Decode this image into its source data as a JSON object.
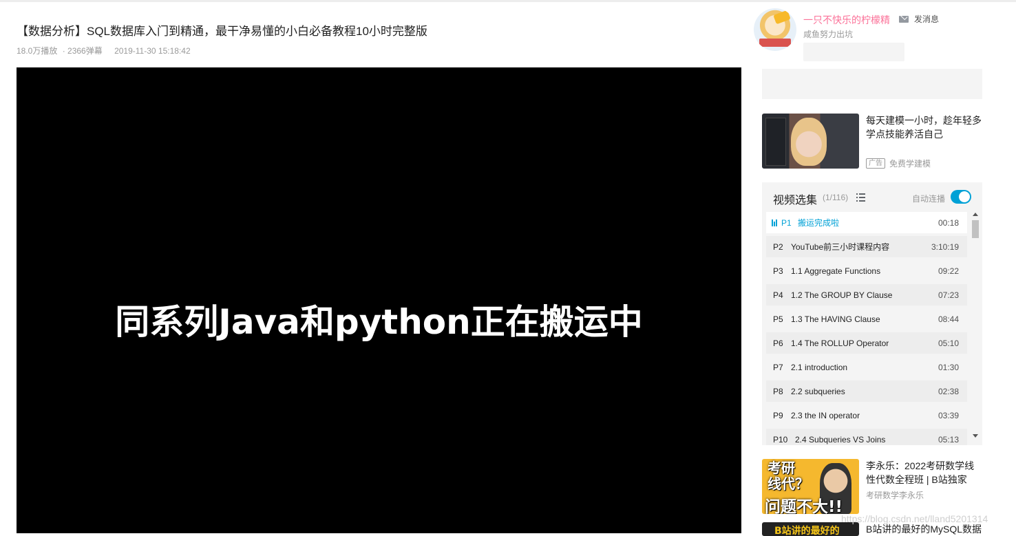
{
  "video": {
    "title": "【数据分析】SQL数据库入门到精通，最干净易懂的小白必备教程10小时完整版",
    "views": "18.0万播放",
    "danmaku": "· 2366弹幕",
    "date": "2019-11-30 15:18:42",
    "subtitle_text": "同系列Java和python正在搬运中"
  },
  "uploader": {
    "name": "一只不快乐的柠檬精",
    "message_label": "发消息",
    "description": "咸鱼努力出坑"
  },
  "ad": {
    "title": "每天建模一小时，趁年轻多学点技能养活自己",
    "badge": "广告",
    "source": "免费学建模"
  },
  "playlist": {
    "title": "视频选集",
    "count": "(1/116)",
    "autoplay_label": "自动连播",
    "autoplay_on": true,
    "items": [
      {
        "p": "P1",
        "title": "搬运完成啦",
        "duration": "00:18",
        "active": true
      },
      {
        "p": "P2",
        "title": "YouTube前三小时课程内容",
        "duration": "3:10:19"
      },
      {
        "p": "P3",
        "title": "1.1 Aggregate Functions",
        "duration": "09:22"
      },
      {
        "p": "P4",
        "title": "1.2 The GROUP BY Clause",
        "duration": "07:23"
      },
      {
        "p": "P5",
        "title": "1.3 The HAVING Clause",
        "duration": "08:44"
      },
      {
        "p": "P6",
        "title": "1.4 The ROLLUP Operator",
        "duration": "05:10"
      },
      {
        "p": "P7",
        "title": "2.1 introduction",
        "duration": "01:30"
      },
      {
        "p": "P8",
        "title": "2.2 subqueries",
        "duration": "02:38"
      },
      {
        "p": "P9",
        "title": "2.3 the IN operator",
        "duration": "03:39"
      },
      {
        "p": "P10",
        "title": "2.4 Subqueries VS Joins",
        "duration": "05:13"
      }
    ]
  },
  "recommended": [
    {
      "title": "李永乐：2022考研数学线性代数全程班 | B站独家",
      "up": "考研数学李永乐",
      "thumb_line1": "考研",
      "thumb_line2": "线代？",
      "thumb_line3": "问题不大!!"
    },
    {
      "title": "B站讲的最好的MySQL数据",
      "thumb_text": "B站讲的最好的"
    }
  ],
  "watermark": "https://blog.csdn.net/lland5201314",
  "colors": {
    "accent": "#00a1d6",
    "uploader_name": "#fb7299",
    "panel_bg": "#f4f4f4"
  }
}
